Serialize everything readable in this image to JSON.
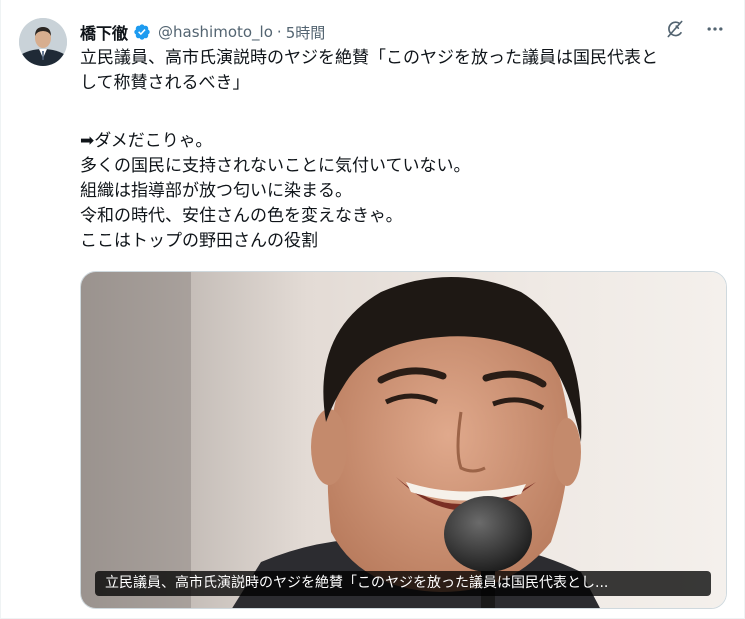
{
  "author": {
    "display_name": "橋下徹",
    "handle": "@hashimoto_lo",
    "separator": "·",
    "time": "5時間",
    "verified": true
  },
  "icons": {
    "verified": "verified-badge-icon",
    "grok": "grok-icon",
    "more": "more-icon"
  },
  "body": {
    "lines": [
      "立民議員、高市氏演説時のヤジを絶賛「このヤジを放った議員は国民代表と",
      "して称賛されるべき」",
      "",
      "➡ダメだこりゃ。",
      "多くの国民に支持されないことに気付いていない。",
      "組織は指導部が放つ匂いに染まる。",
      "令和の時代、安住さんの色を変えなきゃ。",
      "ここはトップの野田さんの役割"
    ]
  },
  "media": {
    "caption": "立民議員、高市氏演説時のヤジを絶賛「このヤジを放った議員は国民代表とし..."
  },
  "colors": {
    "accent": "#1d9bf0",
    "muted": "#536471",
    "text": "#0f1419"
  }
}
